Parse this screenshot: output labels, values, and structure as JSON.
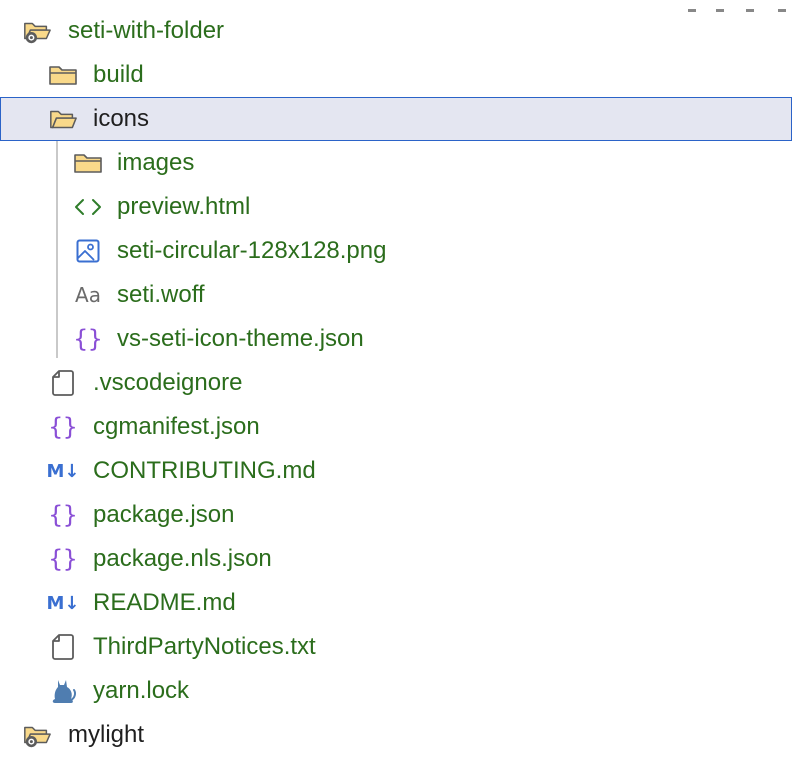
{
  "tree": {
    "items": [
      {
        "label": "seti-with-folder",
        "icon": "folder-open-gear-icon"
      },
      {
        "label": "build",
        "icon": "folder-icon"
      },
      {
        "label": "icons",
        "icon": "folder-open-icon"
      },
      {
        "label": "images",
        "icon": "folder-icon"
      },
      {
        "label": "preview.html",
        "icon": "html-code-icon"
      },
      {
        "label": "seti-circular-128x128.png",
        "icon": "image-file-icon"
      },
      {
        "label": "seti.woff",
        "icon": "font-file-icon",
        "icon_text": "Aa"
      },
      {
        "label": "vs-seti-icon-theme.json",
        "icon": "json-braces-icon",
        "icon_text": "{}"
      },
      {
        "label": ".vscodeignore",
        "icon": "file-icon"
      },
      {
        "label": "cgmanifest.json",
        "icon": "json-braces-icon",
        "icon_text": "{}"
      },
      {
        "label": "CONTRIBUTING.md",
        "icon": "markdown-icon",
        "icon_text": "M↓"
      },
      {
        "label": "package.json",
        "icon": "json-braces-icon",
        "icon_text": "{}"
      },
      {
        "label": "package.nls.json",
        "icon": "json-braces-icon",
        "icon_text": "{}"
      },
      {
        "label": "README.md",
        "icon": "markdown-icon",
        "icon_text": "M↓"
      },
      {
        "label": "ThirdPartyNotices.txt",
        "icon": "file-icon"
      },
      {
        "label": "yarn.lock",
        "icon": "yarn-cat-icon"
      },
      {
        "label": "mylight",
        "icon": "folder-open-gear-icon"
      }
    ],
    "selected_item": "icons"
  },
  "colors": {
    "label_green": "#2b6d1c",
    "label_dark": "#1f1f1f",
    "folder_fill": "#f9d98a",
    "folder_stroke": "#5c5c5c",
    "json_purple": "#8a4fd6",
    "markdown_blue": "#3a6fd1",
    "html_green": "#2f7d2a",
    "selection_bg": "#e4e6f1",
    "selection_border": "#2b63c8"
  }
}
